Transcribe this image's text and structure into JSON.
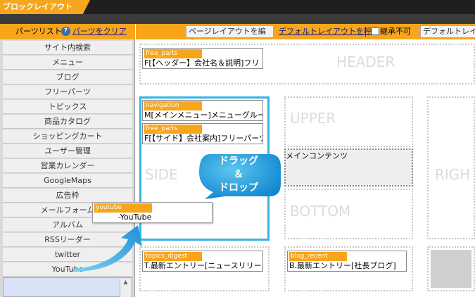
{
  "title_tab": "ブロックレイアウト",
  "sidebar": {
    "header_label": "パーツリスト",
    "clear_link": "パーツをクリア",
    "items": [
      "サイト内検索",
      "メニュー",
      "ブログ",
      "フリーパーツ",
      "トピックス",
      "商品カタログ",
      "ショッピングカート",
      "ユーザー管理",
      "営業カレンダー",
      "GoogleMaps",
      "広告枠",
      "メールフォーム",
      "アルバム",
      "RSSリーダー",
      "twitter",
      "YouTube"
    ]
  },
  "toolbar": {
    "edit_button": "ページレイアウトを編集",
    "default_link": "デフォルトレイアウトを呼出",
    "separator": "|",
    "no_inherit_label": "継承不可",
    "default_button": "デフォルトレイアウ"
  },
  "zones": {
    "header": "HEADER",
    "side": "SIDE",
    "upper": "UPPER",
    "bottom": "BOTTOM",
    "right": "RIGH",
    "main_contents": "メインコンテンツ"
  },
  "parts": {
    "header_free": {
      "tag": "free_parts",
      "text": "F[【ヘッダー】会社名＆説明]フリ"
    },
    "navigation": {
      "tag": "navigation",
      "text": "M[メインメニュー]メニューグループ"
    },
    "side_free": {
      "tag": "free_parts",
      "text": "F[【サイド】会社案内]フリーパーツ"
    },
    "topics": {
      "tag": "topics_digest",
      "text": "T.最新エントリー[ニュースリリース"
    },
    "blog": {
      "tag": "blog_recent",
      "text": "B.最新エントリー[社長ブログ]"
    },
    "dragging": {
      "tag": "youtube",
      "text": "-YouTube"
    }
  },
  "callout": {
    "line1": "ドラッグ",
    "line2": "＆",
    "line3": "ドロップ"
  },
  "colors": {
    "accent": "#f7a51b",
    "drop_target": "#35b3e8",
    "arrow": "#1e90d6"
  }
}
